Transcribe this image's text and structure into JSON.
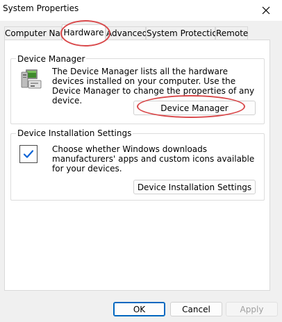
{
  "window": {
    "title": "System Properties",
    "close_icon": "close-icon"
  },
  "tabs": [
    {
      "label": "Computer Name",
      "active": false
    },
    {
      "label": "Hardware",
      "active": true
    },
    {
      "label": "Advanced",
      "active": false
    },
    {
      "label": "System Protection",
      "active": false
    },
    {
      "label": "Remote",
      "active": false
    }
  ],
  "device_manager": {
    "group_title": "Device Manager",
    "description": "The Device Manager lists all the hardware devices installed on your computer. Use the Device Manager to change the properties of any device.",
    "button_label": "Device Manager",
    "icon": "device-manager-icon"
  },
  "device_installation": {
    "group_title": "Device Installation Settings",
    "description": "Choose whether Windows downloads manufacturers' apps and custom icons available for your devices.",
    "button_label": "Device Installation Settings",
    "icon": "checkbox-icon"
  },
  "footer": {
    "ok_label": "OK",
    "cancel_label": "Cancel",
    "apply_label": "Apply"
  },
  "colors": {
    "accent": "#0067c0",
    "annotation": "#d9484a",
    "checkmark": "#0a64d6"
  }
}
